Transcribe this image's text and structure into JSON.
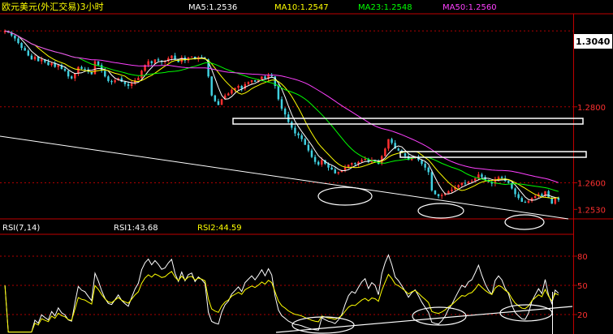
{
  "title": "欧元美元(外汇交易)3小时",
  "ma_legend": [
    {
      "label": "MA5:1.2536",
      "color": "#ffffff"
    },
    {
      "label": "MA10:1.2547",
      "color": "#ffff00"
    },
    {
      "label": "MA23:1.2548",
      "color": "#00ff00"
    },
    {
      "label": "MA50:1.2560",
      "color": "#ff40ff"
    }
  ],
  "rsi_legend": [
    {
      "label": "RSI(7,14)",
      "color": "#ffffff"
    },
    {
      "label": "RSI1:43.68",
      "color": "#ffffff"
    },
    {
      "label": "RSI2:44.59",
      "color": "#ffff00"
    }
  ],
  "price_badge": "1.3040",
  "colors": {
    "up": "#ff3030",
    "down": "#40d0e0",
    "axis": "#c00000",
    "grid": "#b00000",
    "label": "#ff3030"
  },
  "chart_data": [
    {
      "type": "candlestick",
      "title": "欧元美元(外汇交易)3小时",
      "ylim": [
        1.2505,
        1.3045
      ],
      "yticks": [
        1.253,
        1.26,
        1.28
      ],
      "ytick_labels": [
        "1.2530",
        "1.2600",
        "1.2800"
      ],
      "gridlines_at": [
        1.26,
        1.28,
        1.3
      ],
      "n_bars": 165,
      "close": [
        1.3,
        1.2996,
        1.2988,
        1.298,
        1.2968,
        1.2955,
        1.2948,
        1.2935,
        1.2925,
        1.2932,
        1.292,
        1.2925,
        1.2918,
        1.291,
        1.2915,
        1.2905,
        1.291,
        1.29,
        1.2895,
        1.288,
        1.2875,
        1.2888,
        1.2905,
        1.29,
        1.2898,
        1.2892,
        1.2886,
        1.292,
        1.291,
        1.2895,
        1.288,
        1.2868,
        1.2865,
        1.287,
        1.2875,
        1.2866,
        1.286,
        1.2855,
        1.2862,
        1.287,
        1.2876,
        1.2895,
        1.291,
        1.292,
        1.2915,
        1.2925,
        1.2922,
        1.2918,
        1.292,
        1.2928,
        1.2935,
        1.2925,
        1.2918,
        1.293,
        1.2922,
        1.293,
        1.2932,
        1.2925,
        1.293,
        1.2928,
        1.2925,
        1.288,
        1.283,
        1.2815,
        1.2805,
        1.282,
        1.283,
        1.2835,
        1.2845,
        1.285,
        1.2855,
        1.2848,
        1.286,
        1.2865,
        1.287,
        1.2866,
        1.2872,
        1.288,
        1.2875,
        1.2885,
        1.288,
        1.2855,
        1.282,
        1.2795,
        1.278,
        1.276,
        1.2745,
        1.273,
        1.2725,
        1.2715,
        1.27,
        1.2685,
        1.2668,
        1.2655,
        1.2648,
        1.266,
        1.265,
        1.264,
        1.2635,
        1.2625,
        1.2628,
        1.2632,
        1.264,
        1.2648,
        1.2652,
        1.265,
        1.2655,
        1.266,
        1.2663,
        1.2655,
        1.266,
        1.2658,
        1.265,
        1.267,
        1.269,
        1.2715,
        1.2705,
        1.269,
        1.2685,
        1.2678,
        1.267,
        1.266,
        1.2665,
        1.2668,
        1.266,
        1.265,
        1.264,
        1.2628,
        1.258,
        1.257,
        1.2565,
        1.2568,
        1.2572,
        1.2578,
        1.2582,
        1.2588,
        1.2594,
        1.26,
        1.2598,
        1.2603,
        1.2605,
        1.2612,
        1.2622,
        1.2615,
        1.2608,
        1.2602,
        1.2598,
        1.261,
        1.2615,
        1.2612,
        1.2605,
        1.26,
        1.2585,
        1.257,
        1.256,
        1.255,
        1.2548,
        1.2552,
        1.256,
        1.2565,
        1.257,
        1.2565,
        1.2578,
        1.256,
        1.2545,
        1.256,
        1.2555
      ],
      "moving_averages": [
        "MA5",
        "MA10",
        "MA23",
        "MA50"
      ]
    },
    {
      "type": "line",
      "title": "RSI(7,14)",
      "ylim": [
        0,
        100
      ],
      "yticks": [
        20,
        50,
        80
      ],
      "ytick_labels": [
        "20",
        "50",
        "80"
      ],
      "series": [
        {
          "name": "RSI1",
          "color": "#ffffff"
        },
        {
          "name": "RSI2",
          "color": "#ffff00"
        }
      ]
    }
  ]
}
